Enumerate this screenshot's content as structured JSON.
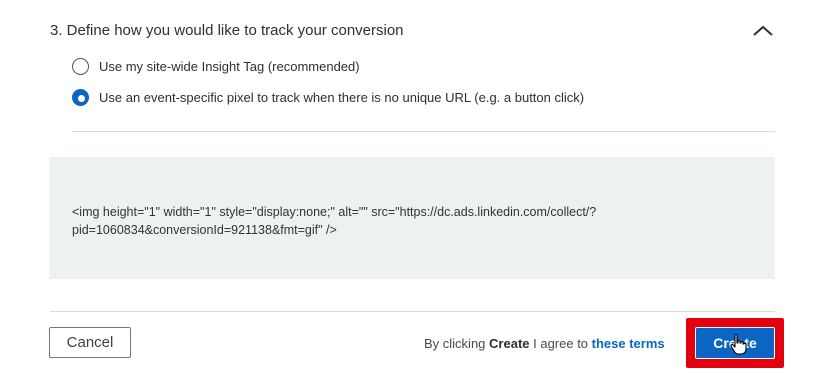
{
  "section": {
    "title": "3. Define how you would like to track your conversion",
    "collapse_icon": "chevron-up-icon"
  },
  "options": [
    {
      "label": "Use my site-wide Insight Tag (recommended)",
      "selected": false
    },
    {
      "label": "Use an event-specific pixel to track when there is no unique URL (e.g. a button click)",
      "selected": true
    }
  ],
  "code": {
    "line1": "<img height=\"1\" width=\"1\" style=\"display:none;\" alt=\"\" src=\"https://dc.ads.linkedin.com/collect/?",
    "line2": "pid=1060834&conversionId=921138&fmt=gif\" />"
  },
  "footer": {
    "cancel_label": "Cancel",
    "agree_prefix": "By clicking ",
    "agree_bold": "Create",
    "agree_middle": " I agree to ",
    "terms_link": "these terms",
    "create_label": "Create"
  },
  "colors": {
    "accent": "#0a66c2",
    "highlight": "#e3000f",
    "code_bg": "#eef1f2"
  }
}
